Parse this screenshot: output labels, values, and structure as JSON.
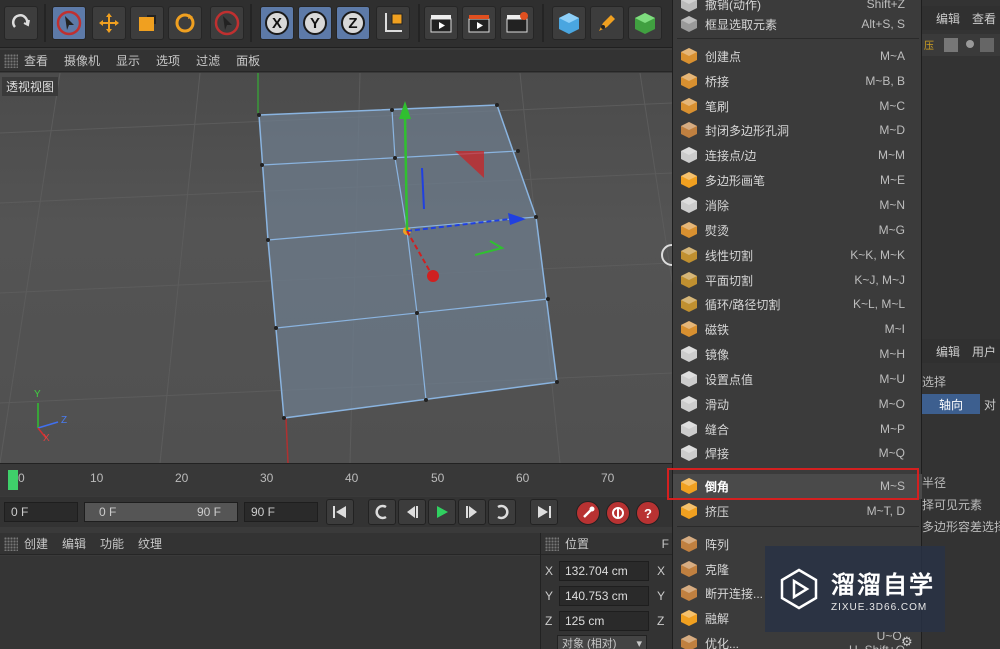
{
  "viewport": {
    "menu": [
      "查看",
      "摄像机",
      "显示",
      "选项",
      "过滤",
      "面板"
    ],
    "label": "透视视图",
    "axes": {
      "y": "Y",
      "z": "Z",
      "x": "X"
    }
  },
  "toolbar": {
    "axis_labels": [
      "X",
      "Y",
      "Z"
    ]
  },
  "timeline": {
    "ticks": [
      "0",
      "10",
      "20",
      "30",
      "40",
      "50",
      "60",
      "70"
    ]
  },
  "transport": {
    "current_frame": "0 F",
    "range_start": "0 F",
    "range_end": "90 F",
    "max_frame": "90 F"
  },
  "bottom_menu": [
    "创建",
    "编辑",
    "功能",
    "纹理"
  ],
  "coords": {
    "header": "位置",
    "header_right": "F",
    "rows": [
      {
        "axis": "X",
        "value": "132.704 cm",
        "next": "X"
      },
      {
        "axis": "Y",
        "value": "140.753 cm",
        "next": "Y"
      },
      {
        "axis": "Z",
        "value": "125 cm",
        "next": "Z"
      }
    ],
    "mode": "对象 (相对)"
  },
  "context_menu": {
    "items": [
      {
        "label": "撤销(动作)",
        "shortcut": "Shift+Z",
        "icon": "undo-icon"
      },
      {
        "label": "框显选取元素",
        "shortcut": "Alt+S, S",
        "icon": "frame-icon"
      },
      {
        "label": "创建点",
        "shortcut": "M~A",
        "icon": "create-point-icon"
      },
      {
        "label": "桥接",
        "shortcut": "M~B, B",
        "icon": "bridge-icon"
      },
      {
        "label": "笔刷",
        "shortcut": "M~C",
        "icon": "brush-icon"
      },
      {
        "label": "封闭多边形孔洞",
        "shortcut": "M~D",
        "icon": "close-hole-icon"
      },
      {
        "label": "连接点/边",
        "shortcut": "M~M",
        "icon": "connect-icon"
      },
      {
        "label": "多边形画笔",
        "shortcut": "M~E",
        "icon": "polygon-pen-icon"
      },
      {
        "label": "消除",
        "shortcut": "M~N",
        "icon": "dissolve-icon"
      },
      {
        "label": "熨烫",
        "shortcut": "M~G",
        "icon": "iron-icon"
      },
      {
        "label": "线性切割",
        "shortcut": "K~K, M~K",
        "icon": "knife-icon"
      },
      {
        "label": "平面切割",
        "shortcut": "K~J, M~J",
        "icon": "plane-cut-icon"
      },
      {
        "label": "循环/路径切割",
        "shortcut": "K~L, M~L",
        "icon": "loop-cut-icon"
      },
      {
        "label": "磁铁",
        "shortcut": "M~I",
        "icon": "magnet-icon"
      },
      {
        "label": "镜像",
        "shortcut": "M~H",
        "icon": "mirror-icon"
      },
      {
        "label": "设置点值",
        "shortcut": "M~U",
        "icon": "set-value-icon"
      },
      {
        "label": "滑动",
        "shortcut": "M~O",
        "icon": "slide-icon"
      },
      {
        "label": "缝合",
        "shortcut": "M~P",
        "icon": "stitch-icon"
      },
      {
        "label": "焊接",
        "shortcut": "M~Q",
        "icon": "weld-icon"
      },
      {
        "label": "倒角",
        "shortcut": "M~S",
        "icon": "bevel-icon"
      },
      {
        "label": "挤压",
        "shortcut": "M~T, D",
        "icon": "extrude-icon"
      },
      {
        "label": "阵列",
        "shortcut": "",
        "icon": "array-icon"
      },
      {
        "label": "克隆",
        "shortcut": "",
        "icon": "clone-icon"
      },
      {
        "label": "断开连接...",
        "shortcut": "",
        "icon": "disconnect-icon"
      },
      {
        "label": "融解",
        "shortcut": "",
        "icon": "melt-icon"
      },
      {
        "label": "优化...",
        "shortcut": "U~O, U~Shift+O",
        "icon": "optimize-icon"
      }
    ]
  },
  "right_panel": {
    "top_tabs": [
      "编辑",
      "查看"
    ],
    "mid_tabs": [
      "编辑",
      "用户"
    ],
    "select_label": "选择",
    "sub_tabs": [
      "轴向",
      "对"
    ],
    "lines": [
      "半径",
      "择可见元素",
      "多边形容差选择"
    ]
  },
  "watermark": {
    "title": "溜溜自学",
    "sub": "ZIXUE.3D66.COM"
  },
  "colors": {
    "highlight_border": "#d42020",
    "playhead": "#3fd06a",
    "active_tool": "#5d7aa8"
  }
}
